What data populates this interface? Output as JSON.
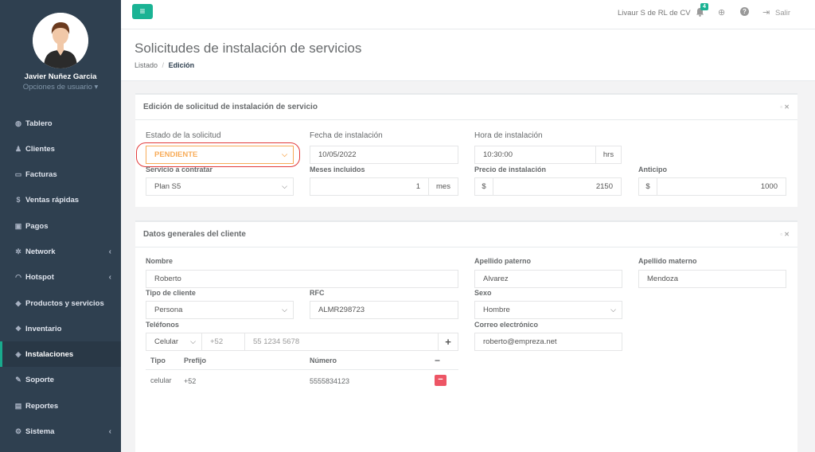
{
  "sidebar": {
    "user_name": "Javier Nuñez Garcia",
    "user_options": "Opciones de usuario ▾",
    "items": [
      {
        "label": "Tablero",
        "icon": "dashboard-icon",
        "glyph": "◍"
      },
      {
        "label": "Clientes",
        "icon": "users-icon",
        "glyph": "♟"
      },
      {
        "label": "Facturas",
        "icon": "file-icon",
        "glyph": "▭"
      },
      {
        "label": "Ventas rápidas",
        "icon": "dollar-icon",
        "glyph": "$"
      },
      {
        "label": "Pagos",
        "icon": "money-icon",
        "glyph": "▣"
      },
      {
        "label": "Network",
        "icon": "network-icon",
        "glyph": "✲"
      },
      {
        "label": "Hotspot",
        "icon": "wifi-icon",
        "glyph": "◠"
      },
      {
        "label": "Productos y servicios",
        "icon": "tag-icon",
        "glyph": "◆"
      },
      {
        "label": "Inventario",
        "icon": "cubes-icon",
        "glyph": "❖"
      },
      {
        "label": "Instalaciones",
        "icon": "diamond-icon",
        "glyph": "◈"
      },
      {
        "label": "Soporte",
        "icon": "wrench-icon",
        "glyph": "✎"
      },
      {
        "label": "Reportes",
        "icon": "book-icon",
        "glyph": "▤"
      },
      {
        "label": "Sistema",
        "icon": "cogs-icon",
        "glyph": "⚙"
      }
    ],
    "active_item": "Instalaciones"
  },
  "topbar": {
    "company": "Livaur S de RL de CV",
    "notifications_count": "4",
    "logout_label": "Salir",
    "menu_glyph": "≡",
    "bell_glyph": "🔔",
    "support_glyph": "⊕",
    "help_glyph": "?",
    "logout_glyph": "⇥"
  },
  "header": {
    "title": "Solicitudes de instalación de servicios",
    "crumb_list": "Listado",
    "crumb_sep": "/",
    "crumb_current": "Edición"
  },
  "solicitud": {
    "title": "Edición de solicitud de instalación de servicio",
    "estado_label": "Estado de la solicitud",
    "estado_value": "PENDIENTE",
    "fecha_label": "Fecha de instalación",
    "fecha_value": "10/05/2022",
    "hora_label": "Hora de instalación",
    "hora_value": "10:30:00",
    "hora_unit": "hrs",
    "servicio_label": "Servicio a contratar",
    "servicio_value": "Plan S5",
    "meses_label": "Meses incluidos",
    "meses_value": "1",
    "meses_unit": "mes",
    "precio_label": "Precio de instalación",
    "precio_currency": "$",
    "precio_value": "2150",
    "anticipo_label": "Anticipo",
    "anticipo_currency": "$",
    "anticipo_value": "1000"
  },
  "cliente": {
    "title": "Datos generales del cliente",
    "nombre_label": "Nombre",
    "nombre_value": "Roberto",
    "ap_paterno_label": "Apellido paterno",
    "ap_paterno_value": "Alvarez",
    "ap_materno_label": "Apellido materno",
    "ap_materno_value": "Mendoza",
    "tipo_label": "Tipo de cliente",
    "tipo_value": "Persona",
    "rfc_label": "RFC",
    "rfc_value": "ALMR298723",
    "sexo_label": "Sexo",
    "sexo_value": "Hombre",
    "telefonos_label": "Teléfonos",
    "tel_tipo_value": "Celular",
    "tel_prefijo_placeholder": "+52",
    "tel_numero_placeholder": "55 1234 5678",
    "correo_label": "Correo electrónico",
    "correo_value": "roberto@empreza.net",
    "table_headers": {
      "tipo": "Tipo",
      "prefijo": "Prefijo",
      "numero": "Número",
      "remove": "−"
    },
    "phones": [
      {
        "tipo": "celular",
        "prefijo": "+52",
        "numero": "5555834123"
      }
    ]
  },
  "colors": {
    "accent": "#1ab394",
    "sidebar": "#2f4050",
    "danger": "#ed5565",
    "pending": "#f8ac59"
  }
}
